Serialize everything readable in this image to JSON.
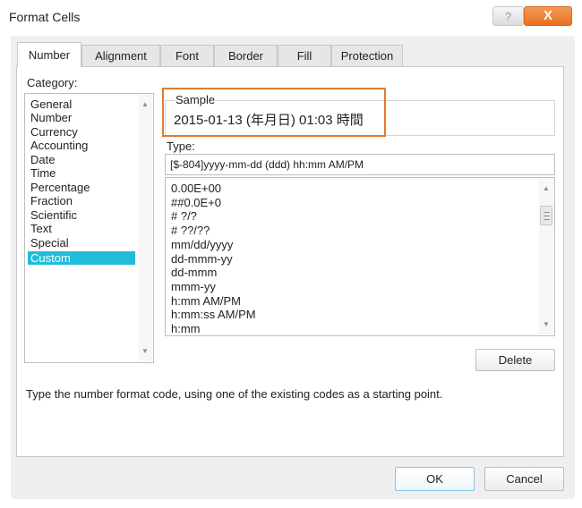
{
  "window": {
    "title": "Format Cells",
    "help_label": "?",
    "close_label": "X"
  },
  "tabs": [
    {
      "label": "Number",
      "active": true
    },
    {
      "label": "Alignment"
    },
    {
      "label": "Font"
    },
    {
      "label": "Border"
    },
    {
      "label": "Fill"
    },
    {
      "label": "Protection"
    }
  ],
  "category": {
    "label": "Category:",
    "items": [
      "General",
      "Number",
      "Currency",
      "Accounting",
      "Date",
      "Time",
      "Percentage",
      "Fraction",
      "Scientific",
      "Text",
      "Special",
      "Custom"
    ],
    "selected": "Custom"
  },
  "sample": {
    "label": "Sample",
    "value": "2015-01-13 (年月日) 01:03 時間"
  },
  "type": {
    "label": "Type:",
    "value": "[$-804]yyyy-mm-dd (ddd)  hh:mm AM/PM",
    "formats": [
      "0.00E+00",
      "##0.0E+0",
      "# ?/?",
      "# ??/??",
      "mm/dd/yyyy",
      "dd-mmm-yy",
      "dd-mmm",
      "mmm-yy",
      "h:mm AM/PM",
      "h:mm:ss AM/PM",
      "h:mm"
    ]
  },
  "buttons": {
    "delete": "Delete",
    "ok": "OK",
    "cancel": "Cancel"
  },
  "description": "Type the number format code, using one of the existing codes as a starting point.",
  "colors": {
    "accent": "#e27a2f",
    "selection": "#20bcd9",
    "close_button": "#e8701f"
  },
  "icons": {
    "scroll_up": "▲",
    "scroll_down": "▼"
  }
}
